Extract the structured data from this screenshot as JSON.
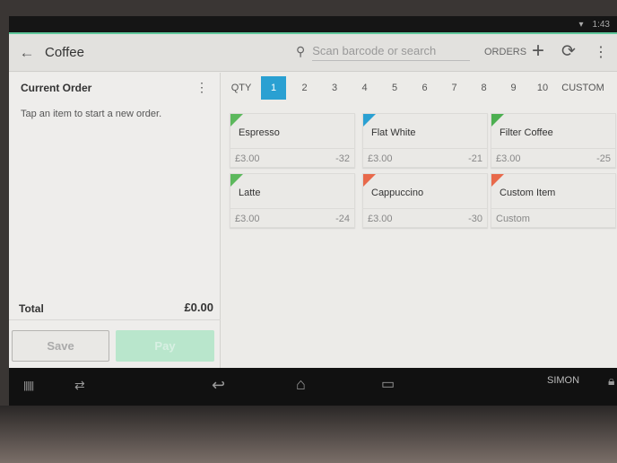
{
  "status": {
    "time": "1:43",
    "wifi_icon": "wifi-icon"
  },
  "appbar": {
    "title": "Coffee",
    "search_placeholder": "Scan barcode or search",
    "orders_label": "ORDERS"
  },
  "order": {
    "title": "Current Order",
    "hint": "Tap an item to start a new order.",
    "total_label": "Total",
    "total_value": "£0.00",
    "save_label": "Save",
    "pay_label": "Pay"
  },
  "qty": {
    "label": "QTY",
    "options": [
      "1",
      "2",
      "3",
      "4",
      "5",
      "6",
      "7",
      "8",
      "9",
      "10"
    ],
    "selected": "1",
    "custom_label": "CUSTOM"
  },
  "colors": {
    "green": "#5cb85c",
    "blue": "#2aa0d2",
    "orange": "#e8694a",
    "accent": "#2aa0d2"
  },
  "items": [
    {
      "name": "Espresso",
      "price": "£3.00",
      "stock": "-32",
      "color": "#5cb85c"
    },
    {
      "name": "Flat White",
      "price": "£3.00",
      "stock": "-21",
      "color": "#2aa0d2"
    },
    {
      "name": "Filter Coffee",
      "price": "£3.00",
      "stock": "-25",
      "color": "#4caf50"
    },
    {
      "name": "Latte",
      "price": "£3.00",
      "stock": "-24",
      "color": "#5cb85c"
    },
    {
      "name": "Cappuccino",
      "price": "£3.00",
      "stock": "-30",
      "color": "#e8694a"
    },
    {
      "name": "Custom Item",
      "price": "Custom",
      "stock": "",
      "color": "#e8694a"
    }
  ],
  "navbar": {
    "user": "SIMON"
  }
}
